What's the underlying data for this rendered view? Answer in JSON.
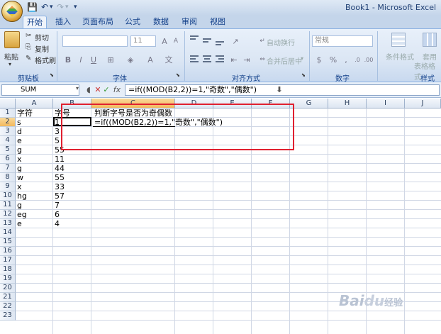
{
  "window": {
    "title": "Book1 - Microsoft Excel"
  },
  "tabs": [
    "开始",
    "插入",
    "页面布局",
    "公式",
    "数据",
    "审阅",
    "视图"
  ],
  "ribbon": {
    "clipboard": {
      "paste": "粘贴",
      "cut": "剪切",
      "copy": "复制",
      "format_painter": "格式刷",
      "label": "剪贴板"
    },
    "font": {
      "font_size": "11",
      "label": "字体"
    },
    "alignment": {
      "wrap_text": "自动换行",
      "merge_center": "合并后居中",
      "label": "对齐方式"
    },
    "number": {
      "format": "常规",
      "label": "数字"
    },
    "styles": {
      "conditional": "条件格式",
      "table_format_1": "套用",
      "table_format_2": "表格格式",
      "label": "样式"
    }
  },
  "formula_bar": {
    "name_box": "SUM",
    "formula": "=if((MOD(B2,2))=1,\"奇数\",\"偶数\")"
  },
  "columns": [
    "A",
    "B",
    "C",
    "D",
    "E",
    "F",
    "G",
    "H",
    "I",
    "J"
  ],
  "rows": [
    "1",
    "2",
    "3",
    "4",
    "5",
    "6",
    "7",
    "8",
    "9",
    "10",
    "11",
    "12",
    "13",
    "14",
    "15",
    "16",
    "17",
    "18",
    "19",
    "20",
    "21",
    "22",
    "23"
  ],
  "cells": {
    "A": [
      "字符",
      "s",
      "d",
      "e",
      "g",
      "x",
      "g",
      "w",
      "x",
      "hg",
      "g",
      "eg",
      "e"
    ],
    "B": [
      "字号",
      "1",
      "3",
      "5",
      "55",
      "11",
      "44",
      "55",
      "33",
      "57",
      "7",
      "6",
      "4"
    ],
    "C1": "判断字号是否为奇偶数",
    "C2": "=if((MOD(B2,2))=1,\"奇数\",\"偶数\")"
  },
  "watermark": {
    "brand": "Bai",
    "brand2": "du",
    "suffix": "经验"
  }
}
